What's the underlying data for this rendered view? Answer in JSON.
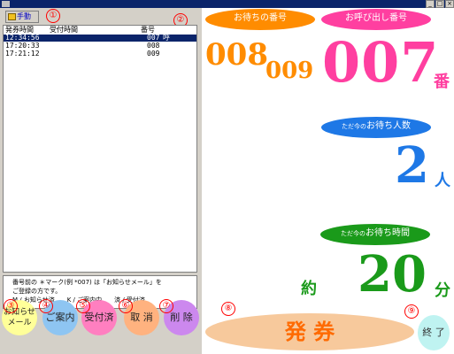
{
  "window": {
    "title": "",
    "minimize": "_",
    "maximize": "□",
    "close": "×"
  },
  "manual_button": {
    "label": "手動"
  },
  "markers": [
    "①",
    "②",
    "③",
    "④",
    "⑤",
    "⑥",
    "⑦",
    "⑧",
    "⑨"
  ],
  "list": {
    "headers": [
      "発券時間",
      "受付時間",
      "番号"
    ],
    "rows": [
      {
        "issued": "12:34:56",
        "accepted": "",
        "number": "007",
        "mark": "呼"
      },
      {
        "issued": "17:20:33",
        "accepted": "",
        "number": "008",
        "mark": ""
      },
      {
        "issued": "17:21:12",
        "accepted": "",
        "number": "009",
        "mark": ""
      }
    ]
  },
  "info": {
    "line1": "番号前の ＊マーク(例 *007) は「お知らせメール」を",
    "line2": "ご登録の方です。",
    "line3": "M / お知らせ済　　K / ご案内中　　済 / 受付済"
  },
  "buttons": {
    "notify_line1": "お知らせ",
    "notify_line2": "メール",
    "guide": "ご案内",
    "accepted": "受付済",
    "cancel": "取 消",
    "delete": "削 除",
    "issue": "発 券",
    "end": "終 了"
  },
  "waiting_numbers": {
    "label": "お待ちの番号",
    "first": "008",
    "second": "009"
  },
  "calling_number": {
    "label": "お呼び出し番号",
    "value": "007",
    "unit": "番"
  },
  "waiting_count": {
    "label_prefix": "ただ今の",
    "label_main": "お待ち人数",
    "value": "2",
    "unit": "人"
  },
  "waiting_time": {
    "label_prefix": "ただ今の",
    "label_main": "お待ち時間",
    "approx": "約",
    "value": "20",
    "unit": "分"
  },
  "colors": {
    "titlebar": "#0a246a",
    "orange": "#ff8c00",
    "pink": "#ff3fa0",
    "blue": "#1e78e6",
    "green": "#1a9a1a",
    "notify_btn": "#ffff99",
    "guide_btn": "#8ec5f2",
    "accepted_btn": "#ff7fc0",
    "cancel_btn": "#ffb27f",
    "delete_btn": "#cc88ee",
    "issue_btn": "#f7c99c",
    "end_btn": "#bff3f1"
  },
  "icons": {
    "manual": "document-icon",
    "app": "app-icon"
  }
}
